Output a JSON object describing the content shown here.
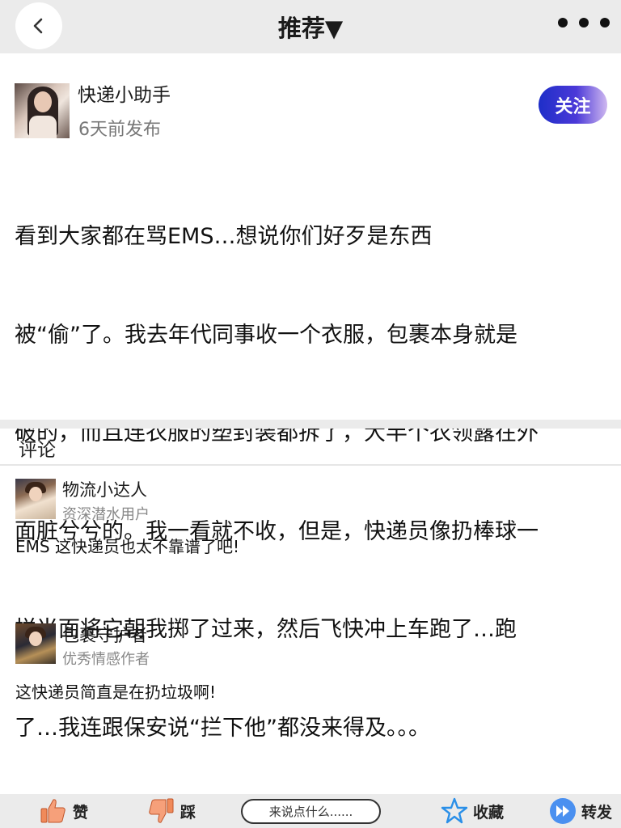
{
  "topbar": {
    "back_icon": "chevron-left-icon",
    "title": "推荐▼",
    "more_icon": "more-dots-icon"
  },
  "post": {
    "author_name": "快递小助手",
    "time": "6天前发布",
    "follow_label": "关注",
    "body_lines": [
      "看到大家都在骂EMS…想说你们好歹是东西",
      "被“偷”了。我去年代同事收一个衣服，包裹本身就是",
      "破的，而且连衣服的塑封装都拆了，大半个衣领露在外",
      "面脏兮兮的。我一看就不收，但是，快递员像扔棒球一",
      "样当面将它朝我掷了过来，然后飞快冲上车跑了…跑",
      "了…我连跟保安说“拦下他”都没来得及。。。"
    ]
  },
  "comments_header": "评论",
  "comments": [
    {
      "name": "物流小达人",
      "badge": "资深潜水用户",
      "text": "EMS 这快递员也太不靠谱了吧!"
    },
    {
      "name": "包裹守护者",
      "badge": "优秀情感作者",
      "text": "这快递员简直是在扔垃圾啊!"
    }
  ],
  "bottombar": {
    "like_label": "赞",
    "like_icon": "thumbs-up-icon",
    "dislike_label": "踩",
    "dislike_icon": "thumbs-down-icon",
    "input_placeholder": "来说点什么......",
    "collect_label": "收藏",
    "collect_icon": "star-icon",
    "share_label": "转发",
    "share_icon": "forward-icon"
  },
  "colors": {
    "follow_gradient_start": "#1e2ec8",
    "follow_gradient_end": "#cfb8f0",
    "star_blue": "#2a8fe8",
    "thumb_orange": "#f08a5a",
    "forward_blue": "#4a90f0"
  }
}
